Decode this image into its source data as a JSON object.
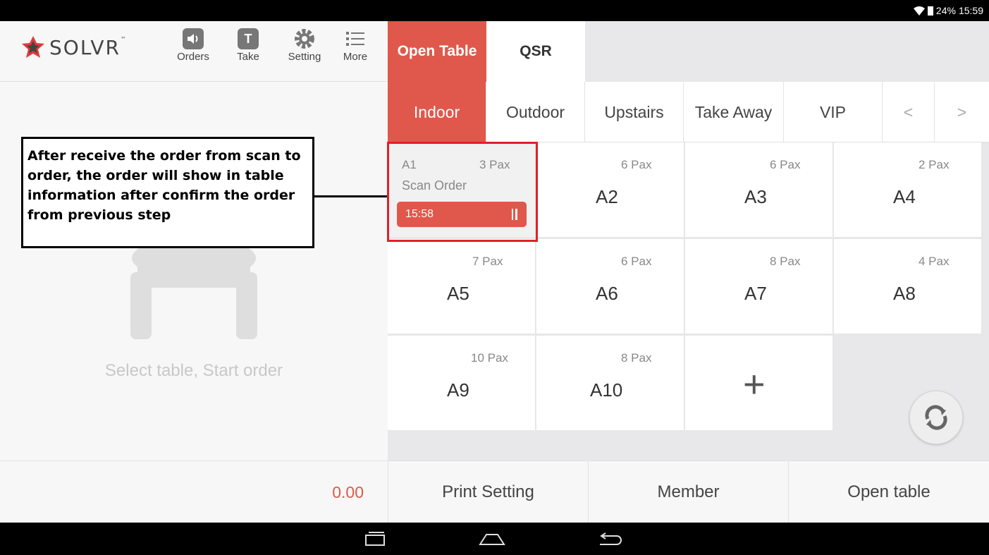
{
  "status_bar": {
    "battery": "24%",
    "time": "15:59"
  },
  "brand": {
    "logo_text": "SOLVR",
    "trademark": "™"
  },
  "toolbar": [
    {
      "label": "Orders",
      "icon": "speaker-icon"
    },
    {
      "label": "Take",
      "icon": "t-icon"
    },
    {
      "label": "Setting",
      "icon": "gear-icon"
    },
    {
      "label": "More",
      "icon": "list-icon"
    }
  ],
  "tabs": {
    "open_table": "Open Table",
    "qsr": "QSR"
  },
  "areas": [
    "Indoor",
    "Outdoor",
    "Upstairs",
    "Take Away",
    "VIP"
  ],
  "area_nav": {
    "prev": "<",
    "next": ">"
  },
  "annotation": "After receive the order from scan to order, the order will show in table information after confirm the order from previous step",
  "left_panel": {
    "empty_hint": "Select table, Start order"
  },
  "table_a1": {
    "name": "A1",
    "pax": "3 Pax",
    "status": "Scan Order",
    "time": "15:58"
  },
  "tables": [
    {
      "name": "A2",
      "pax": "6 Pax"
    },
    {
      "name": "A3",
      "pax": "6 Pax"
    },
    {
      "name": "A4",
      "pax": "2 Pax"
    },
    {
      "name": "A5",
      "pax": "7 Pax"
    },
    {
      "name": "A6",
      "pax": "6 Pax"
    },
    {
      "name": "A7",
      "pax": "8 Pax"
    },
    {
      "name": "A8",
      "pax": "4 Pax"
    },
    {
      "name": "A9",
      "pax": "10 Pax"
    },
    {
      "name": "A10",
      "pax": "8 Pax"
    }
  ],
  "add_table": "+",
  "bottom": {
    "total": "0.00",
    "print_setting": "Print Setting",
    "member": "Member",
    "open_table": "Open table"
  },
  "colors": {
    "accent": "#e0584b",
    "highlight": "#e0202a"
  }
}
